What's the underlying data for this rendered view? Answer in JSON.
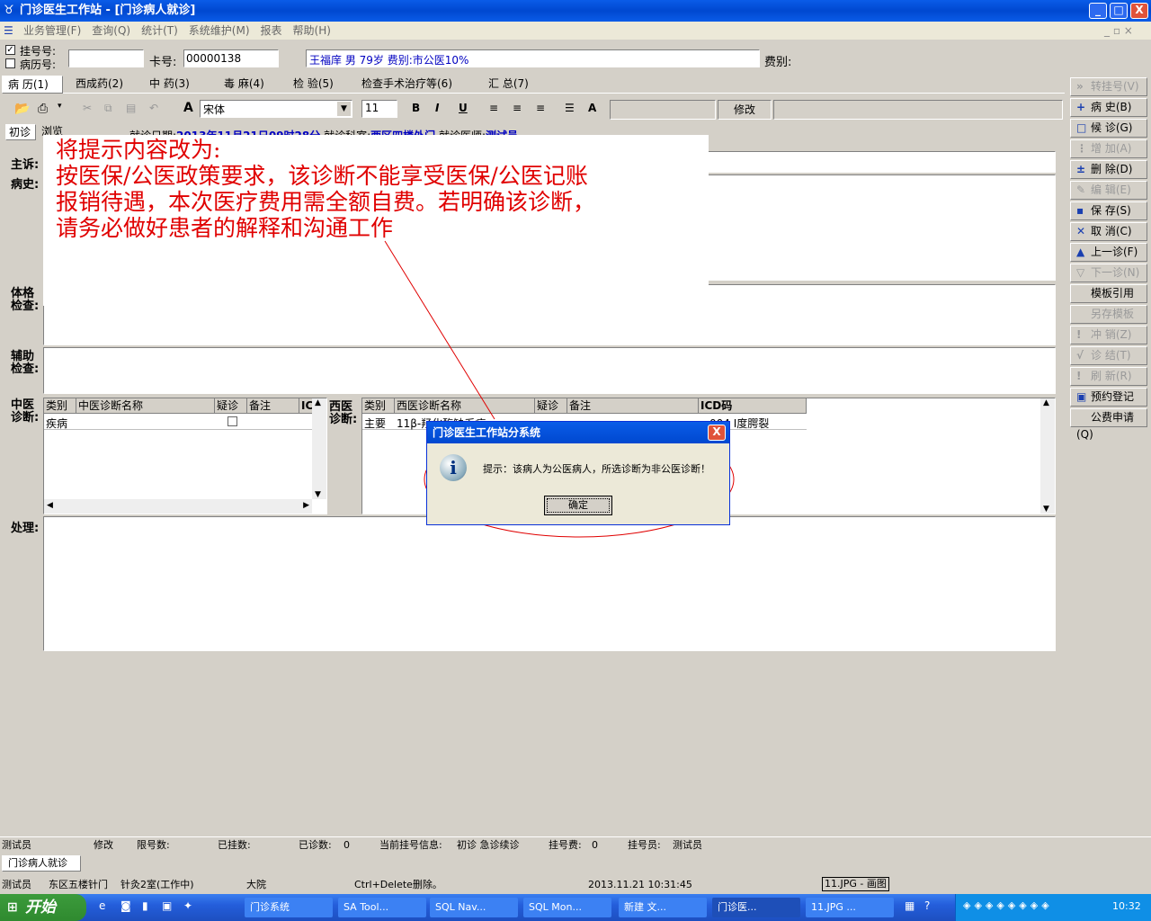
{
  "window": {
    "title": "门诊医生工作站 - [门诊病人就诊]",
    "min": "_",
    "max": "□",
    "close": "X"
  },
  "menu": [
    "业务管理(F)",
    "查询(Q)",
    "统计(T)",
    "系统维护(M)",
    "报表",
    "帮助(H)"
  ],
  "patient_bar": {
    "reg_no_label": "挂号号:",
    "case_no_label": "病历号:",
    "card_label": "卡号:",
    "card_value": "00000138",
    "patient_info": "王福庠 男 79岁 费别:市公医10%",
    "fee_label": "费别:"
  },
  "tabs": [
    "病 历(1)",
    "西成药(2)",
    "中 药(3)",
    "毒 麻(4)",
    "检 验(5)",
    "检查手术治疗等(6)",
    "汇 总(7)"
  ],
  "toolbar": {
    "font": "宋体",
    "size": "11",
    "bold": "B",
    "italic": "I",
    "underline": "U",
    "edit": "修改"
  },
  "subtabs": [
    "初诊",
    "浏览"
  ],
  "visit": {
    "date_label": "就诊日期:",
    "date_value": "2013年11月21日09时28分",
    "dept_label": "就诊科室:",
    "dept_value": "西区四楼外门",
    "doctor_label": "就诊医师:",
    "doctor_value": "测试员"
  },
  "sections": {
    "complaint": "主诉:",
    "history": "病史:",
    "physical": "体格检查:",
    "aux": "辅助检查:",
    "tcm": "中医诊断:",
    "wm": "西医诊断:",
    "treatment": "处理:"
  },
  "physical_prefix": "T",
  "tcm_grid": {
    "headers": [
      "类别",
      "中医诊断名称",
      "疑诊",
      "备注",
      "IC"
    ],
    "row": [
      "疾病",
      "",
      "",
      ""
    ]
  },
  "wm_grid": {
    "headers": [
      "类别",
      "西医诊断名称",
      "疑诊",
      "备注",
      "ICD码"
    ],
    "row": [
      "主要",
      "11β-羟化酶缺乏症",
      "",
      "",
      "004 I度腭裂"
    ]
  },
  "right_buttons": [
    {
      "label": "转挂号(V)",
      "icon": "»",
      "enabled": false
    },
    {
      "label": "病 史(B)",
      "icon": "+",
      "enabled": true
    },
    {
      "label": "候 诊(G)",
      "icon": "□",
      "enabled": true
    },
    {
      "label": "增 加(A)",
      "icon": "⋮",
      "enabled": false
    },
    {
      "label": "删 除(D)",
      "icon": "±",
      "enabled": true
    },
    {
      "label": "编 辑(E)",
      "icon": "✎",
      "enabled": false
    },
    {
      "label": "保 存(S)",
      "icon": "▪",
      "enabled": true
    },
    {
      "label": "取 消(C)",
      "icon": "✕",
      "enabled": true
    },
    {
      "label": "上一诊(F)",
      "icon": "▲",
      "enabled": true
    },
    {
      "label": "下一诊(N)",
      "icon": "▽",
      "enabled": false
    },
    {
      "label": "模板引用(Y)",
      "icon": "",
      "enabled": true
    },
    {
      "label": "另存模板(O)",
      "icon": "",
      "enabled": false
    },
    {
      "label": "冲 销(Z)",
      "icon": "!",
      "enabled": false
    },
    {
      "label": "诊 结(T)",
      "icon": "√",
      "enabled": false
    },
    {
      "label": "刷 新(R)",
      "icon": "!",
      "enabled": false
    },
    {
      "label": "预约登记",
      "icon": "▣",
      "enabled": true
    },
    {
      "label": "公费申请(Q)",
      "icon": "",
      "enabled": true
    }
  ],
  "annotation": {
    "line1": "将提示内容改为:",
    "line2": "按医保/公医政策要求，该诊断不能享受医保/公医记账",
    "line3": "报销待遇，本次医疗费用需全额自费。若明确该诊断，",
    "line4": "请务必做好患者的解释和沟通工作"
  },
  "dialog": {
    "title": "门诊医生工作站分系统",
    "close": "X",
    "message": "提示：该病人为公医病人，所选诊断为非公医诊断！",
    "ok": "确定",
    "info_icon": "i"
  },
  "status1": {
    "user": "测试员",
    "mode": "修改",
    "limit_label": "限号数:",
    "limit": "",
    "registered_label": "已挂数:",
    "registered": "",
    "seen_label": "已诊数:",
    "seen": "0",
    "current_label": "当前挂号信息:",
    "current": "初诊 急诊续诊",
    "fee_label": "挂号费:",
    "fee": "0",
    "reg_user_label": "挂号员:",
    "reg_user": "测试员"
  },
  "window_tab": "门诊病人就诊",
  "status2": {
    "user": "测试员",
    "dept": "东区五楼针门",
    "room": "针灸2室(工作中)",
    "campus": "大院",
    "hint": "Ctrl+Delete删除。",
    "datetime": "2013.11.21 10:31:45",
    "paint": "11.JPG - 画图"
  },
  "taskbar": {
    "start": "开始",
    "items": [
      "门诊系统",
      "SA Tool...",
      "SQL Nav...",
      "SQL Mon...",
      "新建 文...",
      "门诊医...",
      "11.JPG ..."
    ],
    "clock": "10:32"
  }
}
